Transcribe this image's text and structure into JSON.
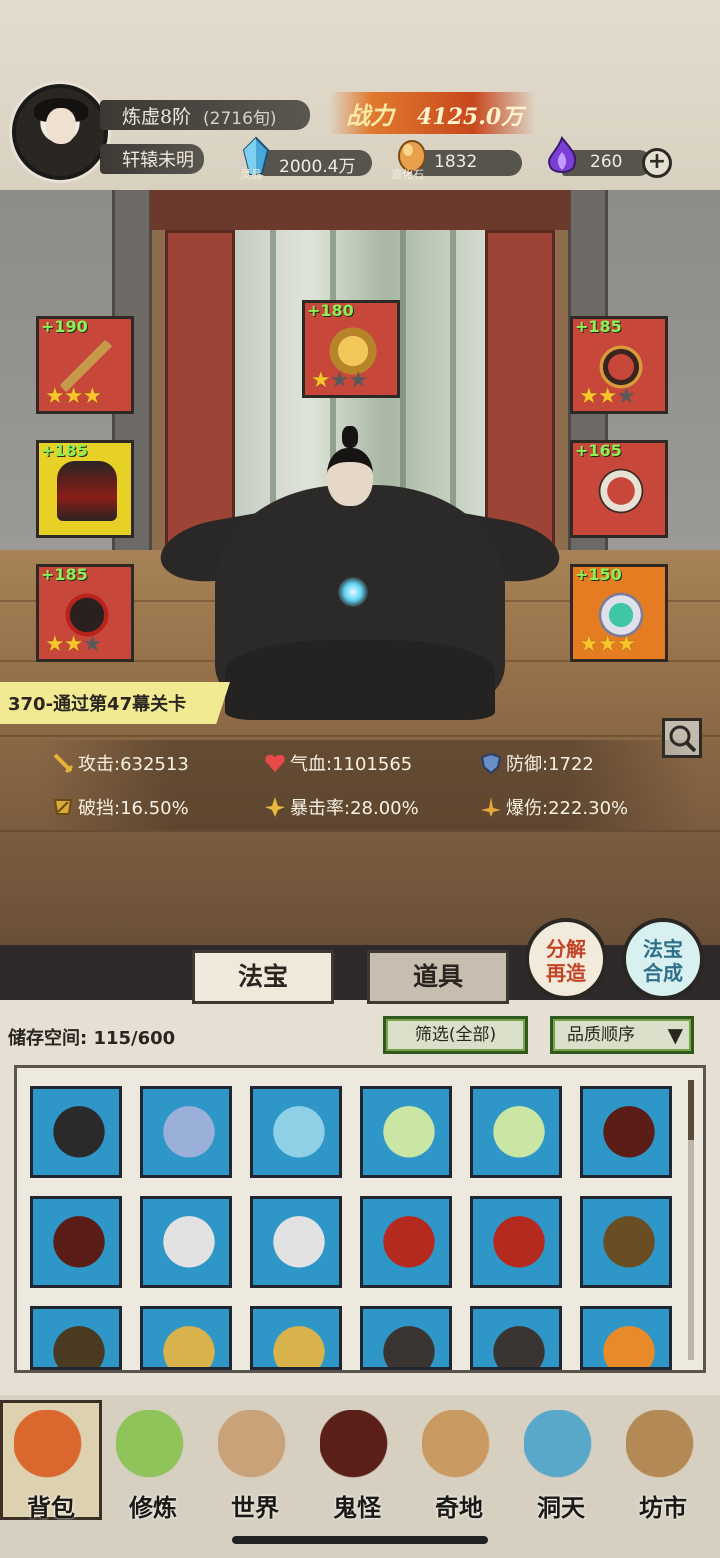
{
  "header": {
    "realm": "炼虚8阶",
    "realm_time": "(2716旬)",
    "player_name": "轩辕未明",
    "power_label": "战力",
    "power_value": "4125.0万",
    "resources": [
      {
        "name": "灵晶",
        "value": "2000.4万",
        "icon": "blue-crystal-icon"
      },
      {
        "name": "造化石",
        "value": "1832",
        "icon": "orange-stone-icon"
      },
      {
        "name": "",
        "value": "260",
        "icon": "purple-flame-icon"
      }
    ],
    "add_label": "+"
  },
  "equipment": [
    {
      "level": "+190",
      "stars": 3,
      "max_stars": 3,
      "color": "#c8473b",
      "icon": "sword-icon"
    },
    {
      "level": "+180",
      "stars": 1,
      "max_stars": 3,
      "color": "#c8473b",
      "icon": "golden-dragon-icon"
    },
    {
      "level": "+185",
      "stars": 2,
      "max_stars": 3,
      "color": "#c8473b",
      "icon": "headband-icon"
    },
    {
      "level": "+185",
      "stars": 0,
      "max_stars": 0,
      "color": "#e7d127",
      "icon": "robe-icon"
    },
    {
      "level": "+165",
      "stars": 0,
      "max_stars": 0,
      "color": "#c8473b",
      "icon": "pendant-icon"
    },
    {
      "level": "+185",
      "stars": 2,
      "max_stars": 3,
      "color": "#c8473b",
      "icon": "boots-icon"
    },
    {
      "level": "+150",
      "stars": 3,
      "max_stars": 3,
      "color": "#e57c22",
      "icon": "ring-icon"
    }
  ],
  "stage": "370-通过第47幕关卡",
  "stats": [
    {
      "label": "攻击:",
      "value": "632513",
      "icon": "sword-stat-icon"
    },
    {
      "label": "气血:",
      "value": "1101565",
      "icon": "heart-icon"
    },
    {
      "label": "防御:",
      "value": "1722",
      "icon": "shield-icon"
    },
    {
      "label": "破挡:",
      "value": "16.50%",
      "icon": "break-icon"
    },
    {
      "label": "暴击率:",
      "value": "28.00%",
      "icon": "crit-icon"
    },
    {
      "label": "爆伤:",
      "value": "222.30%",
      "icon": "crit-damage-icon"
    }
  ],
  "tabs": {
    "fabao": "法宝",
    "daoju": "道具"
  },
  "buttons": {
    "decompose": "分解\n再造",
    "synthesize": "法宝\n合成"
  },
  "storage": "储存空间: 115/600",
  "filter": "筛选(全部)",
  "sort": "品质顺序",
  "inventory": [
    {
      "icon": "spiked-wheel-icon",
      "color": "#2a2a2a"
    },
    {
      "icon": "sword-icon",
      "color": "#9ab0d8"
    },
    {
      "icon": "bow-icon",
      "color": "#8fd0e6"
    },
    {
      "icon": "jade-mirror-icon",
      "color": "#c9e6a4"
    },
    {
      "icon": "jade-mirror-icon",
      "color": "#c9e6a4"
    },
    {
      "icon": "robe-icon",
      "color": "#5a1d18"
    },
    {
      "icon": "robe-icon",
      "color": "#5a1d18"
    },
    {
      "icon": "white-armor-icon",
      "color": "#e2e2e2"
    },
    {
      "icon": "white-armor-icon",
      "color": "#e2e2e2"
    },
    {
      "icon": "red-armor-icon",
      "color": "#b52a1e"
    },
    {
      "icon": "red-armor-icon",
      "color": "#b52a1e"
    },
    {
      "icon": "brown-robe-icon",
      "color": "#6a4d22"
    },
    {
      "icon": "brown-robe-icon",
      "color": "#4a3a22"
    },
    {
      "icon": "gold-armor-icon",
      "color": "#d8b24a"
    },
    {
      "icon": "gold-armor-icon",
      "color": "#d8b24a"
    },
    {
      "icon": "bracer-icon",
      "color": "#3a3530"
    },
    {
      "icon": "bracer-icon",
      "color": "#3a3530"
    },
    {
      "icon": "feather-crown-icon",
      "color": "#e88a2a"
    }
  ],
  "nav": [
    {
      "label": "背包",
      "icon": "bag-icon",
      "color": "#d9672e"
    },
    {
      "label": "修炼",
      "icon": "lotus-icon",
      "color": "#8fc45a"
    },
    {
      "label": "世界",
      "icon": "scroll-icon",
      "color": "#c9a27a"
    },
    {
      "label": "鬼怪",
      "icon": "demon-egg-icon",
      "color": "#5a1f18"
    },
    {
      "label": "奇地",
      "icon": "mountain-icon",
      "color": "#c99b63"
    },
    {
      "label": "洞天",
      "icon": "portal-icon",
      "color": "#59a7c9"
    },
    {
      "label": "坊市",
      "icon": "market-icon",
      "color": "#b38a56"
    }
  ]
}
